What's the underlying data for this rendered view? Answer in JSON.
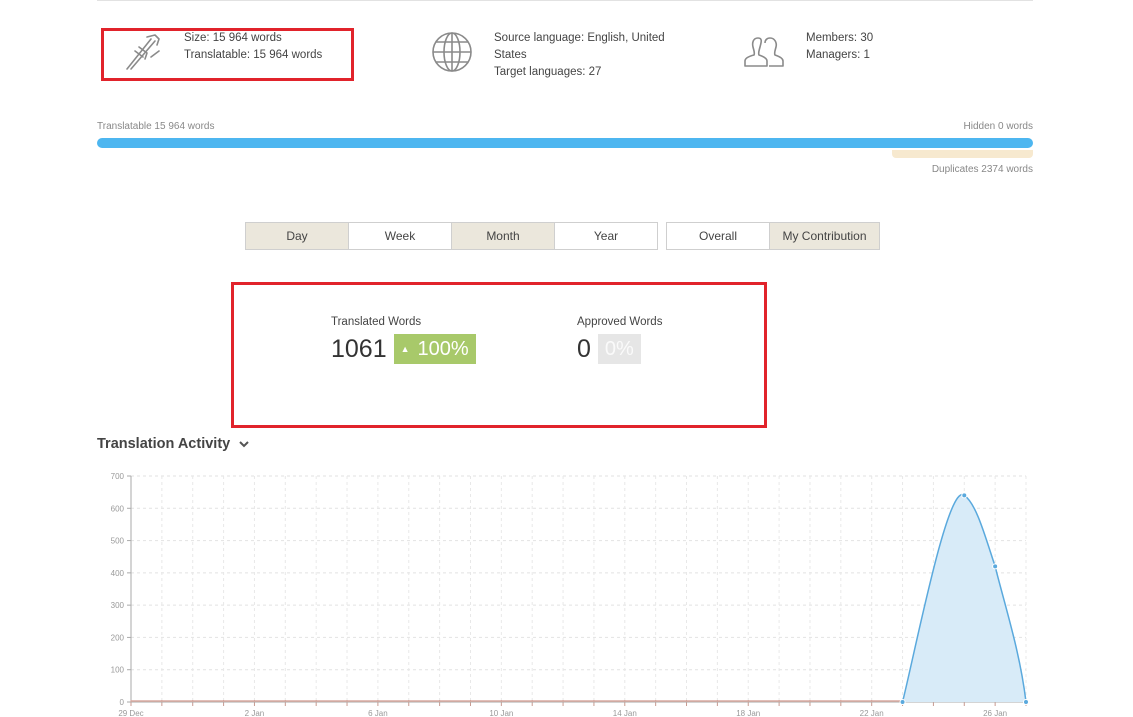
{
  "summary": {
    "size": "Size: 15 964 words",
    "translatable": "Translatable: 15 964 words",
    "source_language": "Source language: English, United States",
    "target_languages": "Target languages: 27",
    "members": "Members: 30",
    "managers": "Managers: 1"
  },
  "progress": {
    "translatable_label": "Translatable 15 964 words",
    "hidden_label": "Hidden 0 words",
    "duplicates_label": "Duplicates 2374 words"
  },
  "period_buttons": [
    {
      "label": "Day",
      "active": true
    },
    {
      "label": "Week",
      "active": false
    },
    {
      "label": "Month",
      "active": true
    },
    {
      "label": "Year",
      "active": false
    }
  ],
  "scope_buttons": [
    {
      "label": "Overall",
      "active": false
    },
    {
      "label": "My Contribution",
      "active": true
    }
  ],
  "metrics": {
    "translated": {
      "label": "Translated Words",
      "value": "1061",
      "badge": "100%"
    },
    "approved": {
      "label": "Approved Words",
      "value": "0",
      "badge": "0%"
    }
  },
  "activity": {
    "title": "Translation Activity"
  },
  "colors": {
    "accent_blue": "#4db6f0",
    "badge_green": "#a8c96a",
    "highlight_red": "#e1232b",
    "duplicates": "#f7e9cf"
  },
  "chart_data": {
    "type": "area",
    "ylim": [
      0,
      700
    ],
    "yticks": [
      0,
      100,
      200,
      300,
      400,
      500,
      600,
      700
    ],
    "x_tick_labels": [
      "29 Dec",
      "2 Jan",
      "6 Jan",
      "10 Jan",
      "14 Jan",
      "18 Jan",
      "22 Jan",
      "26 Jan"
    ],
    "x_tick_days": [
      0,
      4,
      8,
      12,
      16,
      20,
      24,
      28
    ],
    "series": [
      {
        "color": "#5aa9dd",
        "points": [
          [
            25,
            0
          ],
          [
            27,
            640
          ],
          [
            28,
            420
          ],
          [
            29,
            0
          ]
        ]
      },
      {
        "color": "#d9a9a0",
        "points": [
          [
            0,
            0
          ],
          [
            29,
            0
          ]
        ]
      }
    ]
  }
}
